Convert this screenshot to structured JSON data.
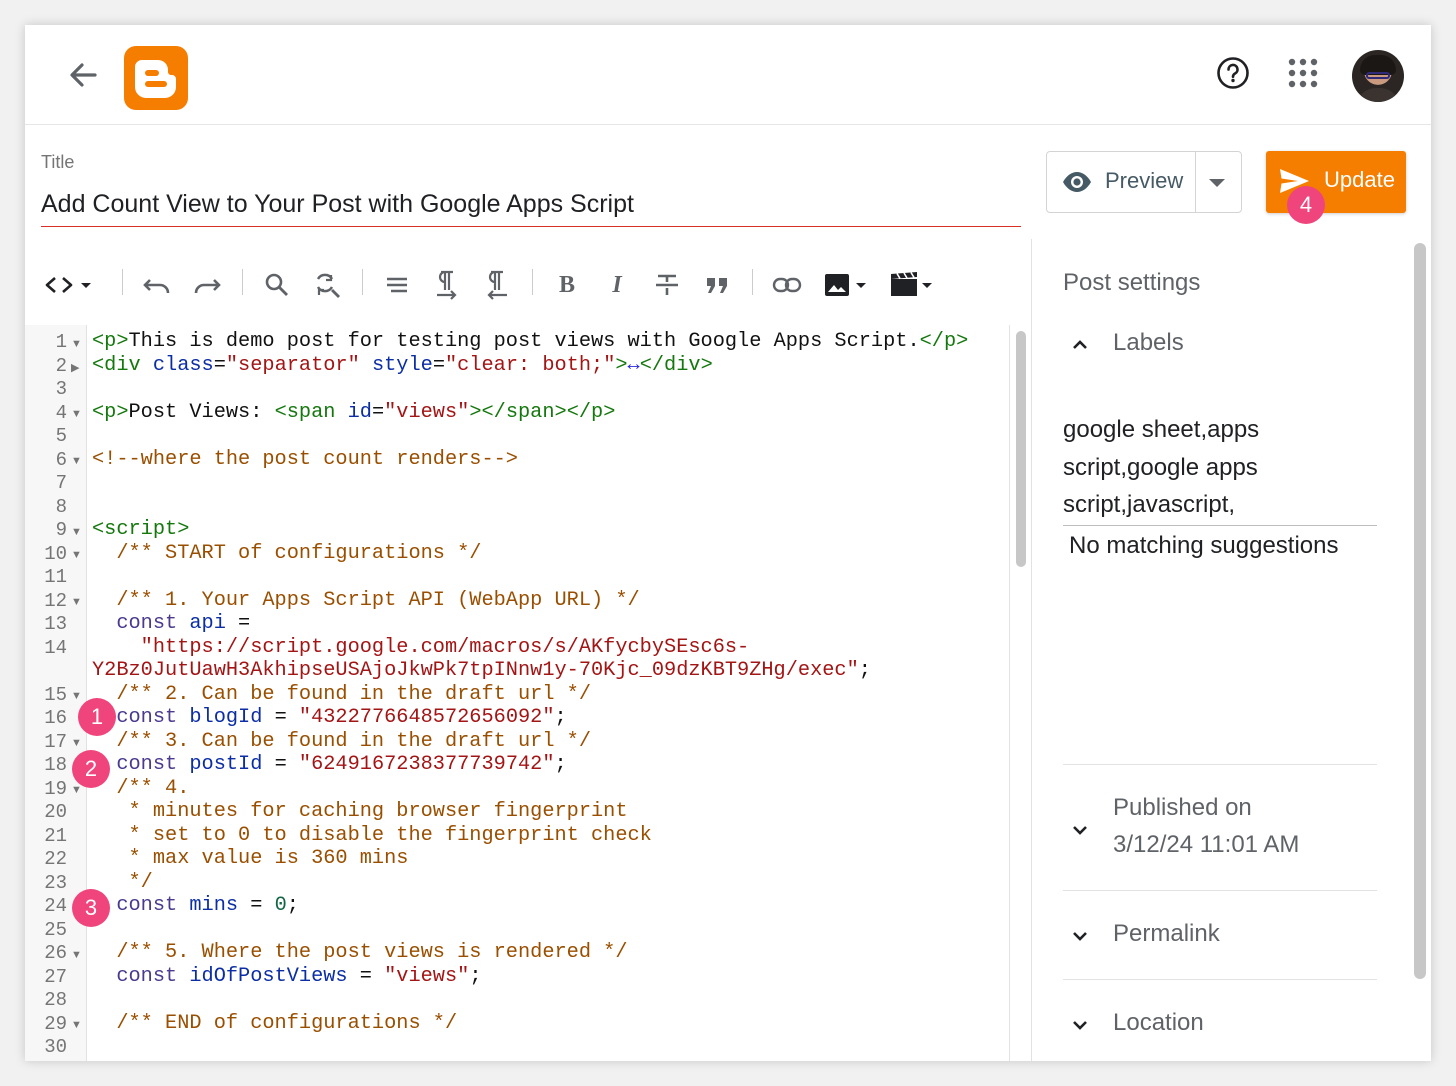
{
  "header": {
    "back_icon": "arrow-left-icon",
    "logo": "blogger-logo",
    "help_icon": "help-circle-icon",
    "apps_icon": "apps-grid-icon"
  },
  "title": {
    "label": "Title",
    "value": "Add Count View to Your Post with Google Apps Script"
  },
  "actions": {
    "preview_label": "Preview",
    "update_label": "Update"
  },
  "badges": [
    "1",
    "2",
    "3",
    "4"
  ],
  "toolbar": {
    "bold": "B",
    "italic": "I",
    "icons": [
      "html-view-icon",
      "undo-icon",
      "redo-icon",
      "search-icon",
      "find-replace-icon",
      "format-icon",
      "ltr-icon",
      "rtl-icon",
      "bold-icon",
      "italic-icon",
      "strikethrough-icon",
      "quote-icon",
      "link-icon",
      "image-icon",
      "video-icon"
    ]
  },
  "editor": {
    "line_numbers": [
      "1",
      "2",
      "3",
      "4",
      "5",
      "6",
      "7",
      "8",
      "9",
      "10",
      "11",
      "12",
      "13",
      "14",
      "15",
      "16",
      "17",
      "18",
      "19",
      "20",
      "21",
      "22",
      "23",
      "24",
      "25",
      "26",
      "27",
      "28",
      "29",
      "30"
    ],
    "lines": {
      "l1": [
        "<p>",
        "This is demo post for testing post views with Google Apps Script.",
        "</p>"
      ],
      "l2": [
        "<div ",
        "class",
        "=",
        "\"separator\"",
        "style",
        "=",
        "\"clear: both;\"",
        ">",
        "↔",
        "</div>"
      ],
      "l4": [
        "<p>",
        "Post Views: ",
        "<span ",
        "id",
        "=",
        "\"views\"",
        "></span></p>"
      ],
      "l6": "<!--where the post count renders-->",
      "l9": "<script>",
      "l10": "  /** START of configurations */",
      "l12": "  /** 1. Your Apps Script API (WebApp URL) */",
      "l13": [
        "  const ",
        "api",
        " ="
      ],
      "l14a": "    \"https://script.google.com/macros/s/AKfycbySEsc6s-",
      "l14b": "Y2Bz0JutUawH3AkhipseUSAjoJkwPk7tpINnw1y-70Kjc_09dzKBT9ZHg/exec\"",
      "l14c": ";",
      "l15": "  /** 2. Can be found in the draft url */",
      "l16": [
        "  const ",
        "blogId",
        " = ",
        "\"4322776648572656092\"",
        ";"
      ],
      "l17": "  /** 3. Can be found in the draft url */",
      "l18": [
        "  const ",
        "postId",
        " = ",
        "\"6249167238377739742\"",
        ";"
      ],
      "l19": "  /** 4.",
      "l20": "   * minutes for caching browser fingerprint",
      "l21": "   * set to 0 to disable the fingerprint check",
      "l22": "   * max value is 360 mins",
      "l23": "   */",
      "l24": [
        "  const ",
        "mins",
        " = ",
        "0",
        ";"
      ],
      "l26": "  /** 5. Where the post views is rendered */",
      "l27": [
        "  const ",
        "idOfPostViews",
        " = ",
        "\"views\"",
        ";"
      ],
      "l29": "  /** END of configurations */"
    }
  },
  "sidebar": {
    "title": "Post settings",
    "labels_heading": "Labels",
    "labels_value_lines": [
      "google sheet,apps",
      "script,google apps",
      "script,javascript,"
    ],
    "no_matching": "No matching suggestions",
    "published_heading": "Published on",
    "published_value": "3/12/24 11:01 AM",
    "permalink_heading": "Permalink",
    "location_heading": "Location"
  },
  "colors": {
    "accent": "#f57d00",
    "badge": "#f0457c",
    "title_underline": "#d93025"
  }
}
